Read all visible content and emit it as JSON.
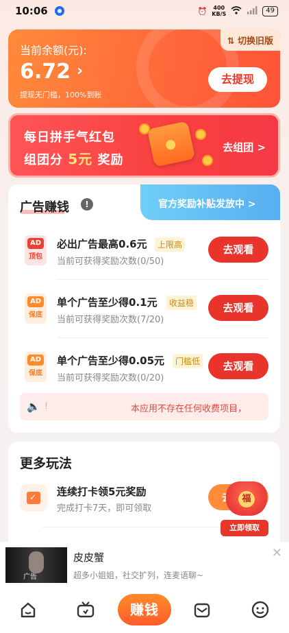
{
  "status_bar": {
    "time": "10:06",
    "speed_top": "400",
    "speed_bottom": "KB/S",
    "battery": "49"
  },
  "balance": {
    "label": "当前余额(元):",
    "amount": "6.72",
    "note": "提现无门槛，100%到账",
    "switch_label": "切换旧版",
    "withdraw_label": "去提现"
  },
  "group_banner": {
    "line1": "每日拼手气红包",
    "line2_prefix": "组团分",
    "line2_highlight": "5元",
    "line2_suffix": "奖励",
    "go_label": "去组团 >"
  },
  "ads_section": {
    "title": "广告赚钱",
    "subsidy_label": "官方奖励补贴发放中 >",
    "rows": [
      {
        "badge_top": "AD",
        "badge_bottom": "顶包",
        "name": "必出广告最高0.6元",
        "tag": "上限高",
        "count": "当前可获得奖励次数(0/50)",
        "button": "去观看"
      },
      {
        "badge_top": "AD",
        "badge_bottom": "保底",
        "name": "单个广告至少得0.1元",
        "tag": "收益稳",
        "count": "当前可获得奖励次数(7/20)",
        "button": "去观看"
      },
      {
        "badge_top": "AD",
        "badge_bottom": "保底",
        "name": "单个广告至少得0.05元",
        "tag": "门槛低",
        "count": "当前可获得奖励次数(0/20)",
        "button": "去观看"
      }
    ],
    "notice_mark": "!",
    "notice": "本应用不存在任何收费项目，"
  },
  "more_section": {
    "title": "更多玩法",
    "item": {
      "name": "连续打卡领5元奖励",
      "desc": "完成打卡7天，即可领取",
      "button": "去"
    },
    "bag_char": "福",
    "claim_label": "立即领取"
  },
  "ad_overlay": {
    "thumb_label": "广告",
    "title": "皮皮蟹",
    "desc": "超多小姐姐，社交扩列，连麦语聊~"
  },
  "bottom_nav": {
    "center_label": "赚钱",
    "items": [
      "home-icon",
      "tv-icon",
      "earn-icon",
      "message-icon",
      "profile-icon"
    ]
  },
  "colors": {
    "primary_red": "#e8342b",
    "balance_orange": "#ff6a3a",
    "subsidy_blue": "#58aef2"
  }
}
